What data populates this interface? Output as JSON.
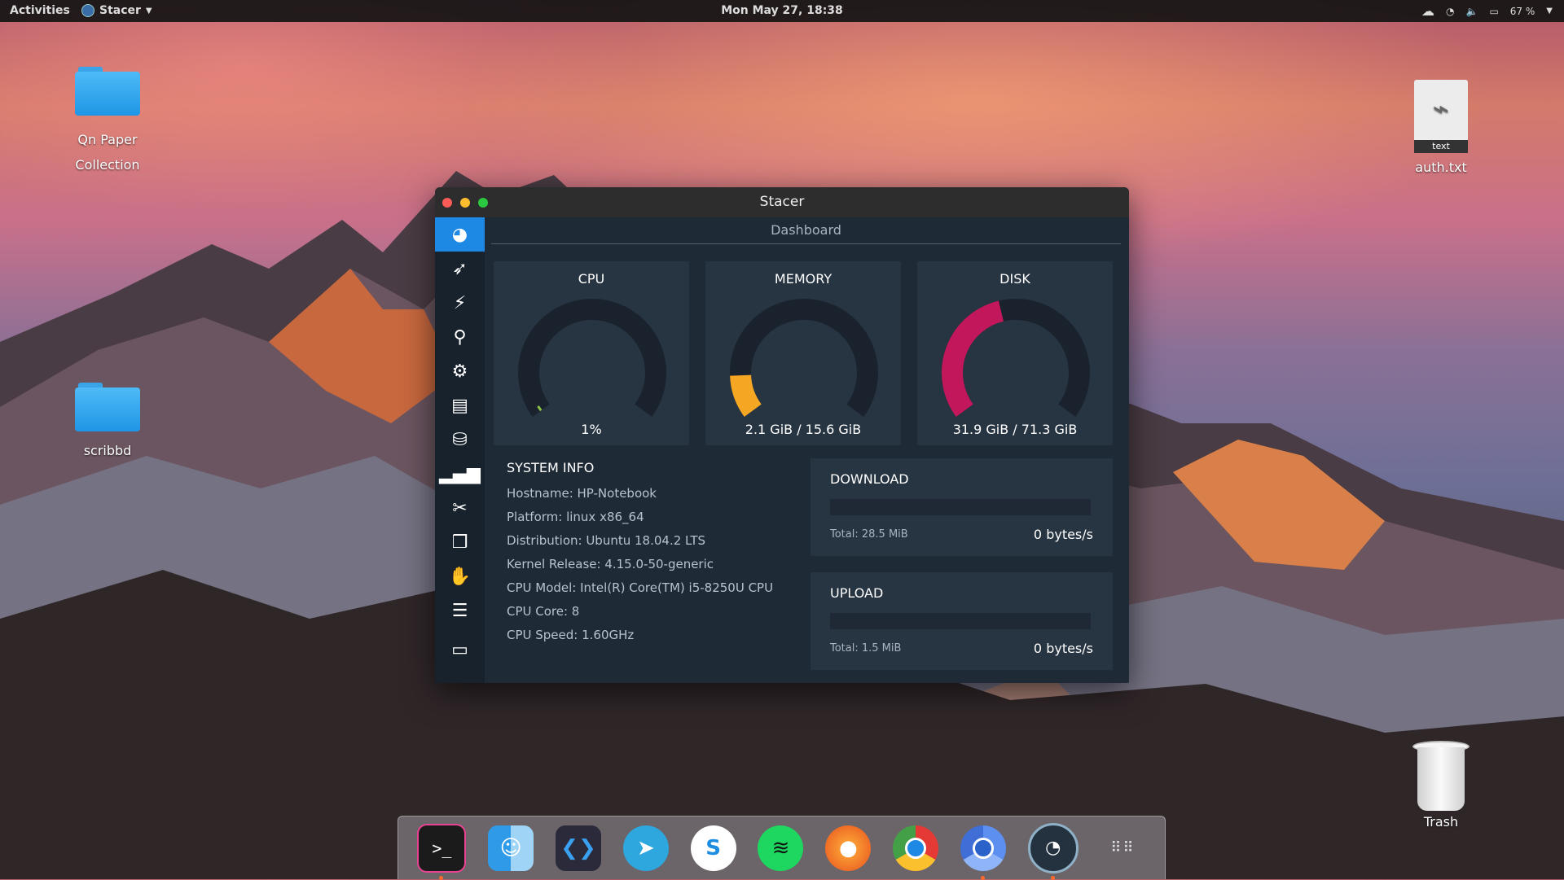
{
  "topbar": {
    "activities": "Activities",
    "app_menu": "Stacer",
    "clock": "Mon May 27, 18:38",
    "battery": "67 %"
  },
  "desktop": {
    "icons": [
      {
        "label": "Qn Paper Collection"
      },
      {
        "label": "scribbd"
      },
      {
        "label": "auth.txt",
        "badge": "text"
      },
      {
        "label": "Trash"
      }
    ]
  },
  "window": {
    "title": "Stacer",
    "page_title": "Dashboard",
    "sidebar": [
      {
        "icon": "dashboard-icon",
        "active": true
      },
      {
        "icon": "rocket-icon"
      },
      {
        "icon": "broom-icon"
      },
      {
        "icon": "search-icon"
      },
      {
        "icon": "gears-icon"
      },
      {
        "icon": "processes-icon"
      },
      {
        "icon": "uninstaller-icon"
      },
      {
        "icon": "resources-chart-icon"
      },
      {
        "icon": "tools-icon"
      },
      {
        "icon": "package-icon"
      },
      {
        "icon": "gnome-settings-icon"
      },
      {
        "icon": "sliders-icon"
      },
      {
        "icon": "feedback-icon"
      }
    ],
    "cpu": {
      "title": "CPU",
      "value": "1%",
      "percent": 0.01,
      "color": "#8bc34a"
    },
    "memory": {
      "title": "MEMORY",
      "value": "2.1 GiB / 15.6 GiB",
      "percent": 0.135,
      "color": "#f5a623"
    },
    "disk": {
      "title": "DISK",
      "value": "31.9 GiB / 71.3 GiB",
      "percent": 0.447,
      "color": "#c2185b"
    },
    "system_info": {
      "heading": "SYSTEM INFO",
      "rows": [
        "Hostname: HP-Notebook",
        "Platform: linux x86_64",
        "Distribution: Ubuntu 18.04.2 LTS",
        "Kernel Release: 4.15.0-50-generic",
        "CPU Model: Intel(R) Core(TM) i5-8250U CPU",
        "CPU Core: 8",
        "CPU Speed: 1.60GHz"
      ]
    },
    "download": {
      "heading": "DOWNLOAD",
      "total": "Total: 28.5 MiB",
      "speed": "0 bytes/s"
    },
    "upload": {
      "heading": "UPLOAD",
      "total": "Total: 1.5 MiB",
      "speed": "0 bytes/s"
    }
  },
  "dock": [
    {
      "name": "terminal"
    },
    {
      "name": "finder"
    },
    {
      "name": "vscode"
    },
    {
      "name": "telegram"
    },
    {
      "name": "skype"
    },
    {
      "name": "spotify"
    },
    {
      "name": "firefox"
    },
    {
      "name": "chrome"
    },
    {
      "name": "chromium"
    },
    {
      "name": "stacer"
    },
    {
      "name": "show-apps"
    }
  ]
}
